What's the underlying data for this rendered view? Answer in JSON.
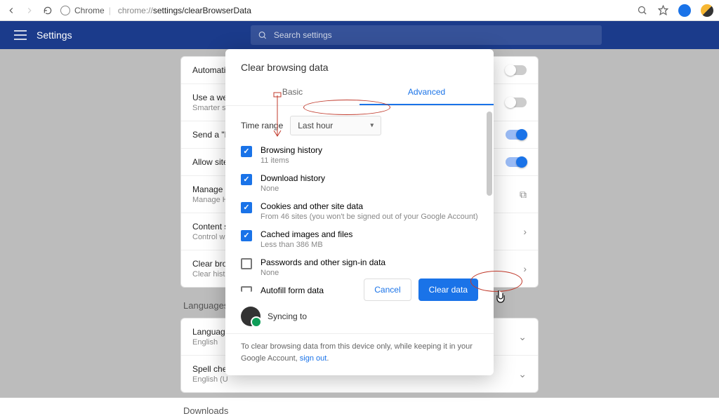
{
  "browser": {
    "chip": "Chrome",
    "url_prefix": "chrome://",
    "url_path": "settings/clearBrowserData"
  },
  "header": {
    "title": "Settings",
    "search_placeholder": "Search settings"
  },
  "settings_rows": {
    "auto": "Automatic...",
    "web": "Use a web",
    "web_sub": "Smarter sp",
    "dnt": "Send a \"Do",
    "allow": "Allow sites",
    "manage": "Manage ce",
    "manage_sub": "Manage HT",
    "content": "Content se",
    "content_sub": "Control wh",
    "clear": "Clear brow",
    "clear_sub": "Clear histo"
  },
  "sections": {
    "languages": "Languages",
    "language_row": "Language",
    "language_sub": "English",
    "spell_row": "Spell chec",
    "spell_sub": "English (U",
    "downloads": "Downloads"
  },
  "modal": {
    "title": "Clear browsing data",
    "tab_basic": "Basic",
    "tab_advanced": "Advanced",
    "time_range_label": "Time range",
    "time_range_value": "Last hour",
    "items": [
      {
        "label": "Browsing history",
        "sub": "11 items",
        "checked": true
      },
      {
        "label": "Download history",
        "sub": "None",
        "checked": true
      },
      {
        "label": "Cookies and other site data",
        "sub": "From 46 sites (you won't be signed out of your Google Account)",
        "checked": true
      },
      {
        "label": "Cached images and files",
        "sub": "Less than 386 MB",
        "checked": true
      },
      {
        "label": "Passwords and other sign-in data",
        "sub": "None",
        "checked": false
      },
      {
        "label": "Autofill form data",
        "sub": "",
        "checked": false
      }
    ],
    "cancel": "Cancel",
    "clear": "Clear data",
    "syncing": "Syncing to",
    "blurb_a": "To clear browsing data from this device only, while keeping it in your Google Account, ",
    "signout": "sign out"
  }
}
